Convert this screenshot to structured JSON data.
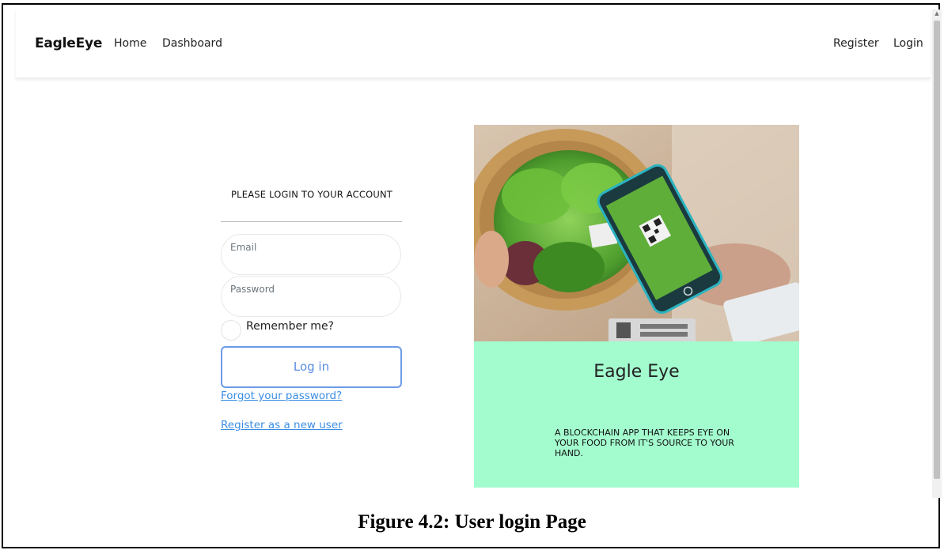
{
  "nav": {
    "brand": "EagleEye",
    "links": [
      "Home",
      "Dashboard"
    ],
    "right_links": [
      "Register",
      "Login"
    ]
  },
  "login": {
    "heading": "PLEASE LOGIN TO YOUR ACCOUNT",
    "email_label": "Email",
    "password_label": "Password",
    "remember_label": "Remember me?",
    "login_button": "Log in",
    "forgot_link": "Forgot your password?",
    "register_link": "Register as a new user"
  },
  "promo": {
    "title": "Eagle Eye",
    "text": "A BLOCKCHAIN APP THAT KEEPS EYE ON YOUR FOOD FROM IT'S SOURCE TO YOUR HAND."
  },
  "caption": "Figure 4.2: User login Page",
  "colors": {
    "promo_bg": "#a3fcce",
    "link": "#3b8de4",
    "button_border": "#6d9be8"
  }
}
